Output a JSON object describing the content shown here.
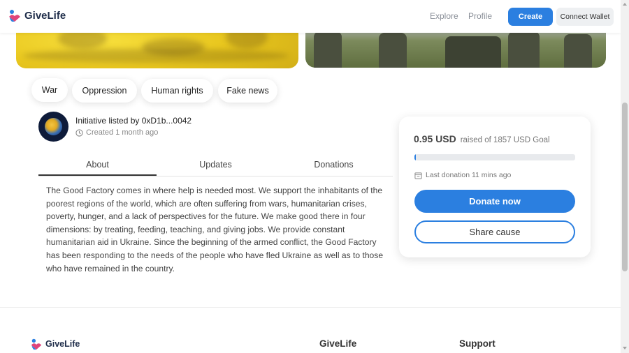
{
  "header": {
    "logo_text": "GiveLife",
    "nav": {
      "explore": "Explore",
      "profile": "Profile"
    },
    "create_label": "Create",
    "wallet_label": "Connect Wallet"
  },
  "tags": [
    "War",
    "Oppression",
    "Human rights",
    "Fake news"
  ],
  "initiative": {
    "listed_by": "Initiative listed by 0xD1b...0042",
    "created": "Created 1 month ago"
  },
  "tabs": [
    "About",
    "Updates",
    "Donations"
  ],
  "about_text": "The Good Factory comes in where help is needed most. We support the inhabitants of the poorest regions of the world, which are often suffering from wars, humanitarian crises, poverty, hunger, and a lack of perspectives for the future. We make good there in four dimensions: by treating, feeding, teaching, and giving jobs. We provide constant humanitarian aid in Ukraine. Since the beginning of the armed conflict, the Good Factory has been responding to the needs of the people who have fled Ukraine as well as to those who have remained in the country.",
  "donation": {
    "raised_amount": "0.95 USD",
    "goal_text": "raised of 1857 USD Goal",
    "progress_fraction": 0.0005,
    "last_donation": "Last donation 11 mins ago",
    "donate_label": "Donate now",
    "share_label": "Share cause"
  },
  "footer": {
    "logo_text": "GiveLife",
    "col1_title": "GiveLife",
    "col2_title": "Support"
  },
  "colors": {
    "accent": "#2b7fe0",
    "hero_left": "#f2d52e"
  }
}
